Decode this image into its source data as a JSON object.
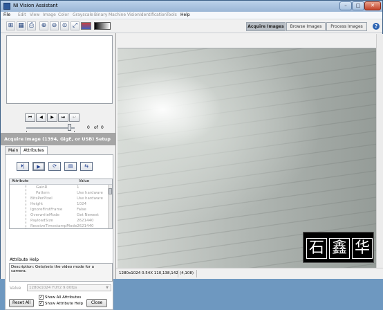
{
  "window": {
    "title": "NI Vision Assistant",
    "close_glyph": "✕",
    "min_glyph": "–",
    "max_glyph": "□"
  },
  "menu": [
    {
      "label": "File",
      "disabled": false
    },
    {
      "label": "Edit",
      "disabled": true
    },
    {
      "label": "View",
      "disabled": true
    },
    {
      "label": "Image",
      "disabled": true
    },
    {
      "label": "Color",
      "disabled": true
    },
    {
      "label": "Grayscale",
      "disabled": true
    },
    {
      "label": "Binary",
      "disabled": true
    },
    {
      "label": "Machine Vision",
      "disabled": true
    },
    {
      "label": "Identification",
      "disabled": true
    },
    {
      "label": "Tools",
      "disabled": true
    },
    {
      "label": "Help",
      "disabled": false
    }
  ],
  "toolbar": {
    "icons": [
      "acquire-icon",
      "browse-icon",
      "print-icon",
      "zoom-in-icon",
      "zoom-out-icon",
      "zoom-1to1-icon",
      "zoom-fit-icon",
      "color-palette-icon",
      "grayscale-gradient-icon"
    ],
    "glyphs": [
      "⊞",
      "▦",
      "⎙",
      "⊕",
      "⊖",
      "⊙",
      "⤢"
    ]
  },
  "modes": [
    {
      "label": "Acquire Images",
      "active": true
    },
    {
      "label": "Browse Images",
      "active": false
    },
    {
      "label": "Process Images",
      "active": false
    }
  ],
  "help_glyph": "?",
  "thumbnail_nav": {
    "first": "⏮",
    "prev": "◀",
    "next": "▶",
    "last": "⏭",
    "undo": "↩",
    "current": "0",
    "of_label": "of",
    "total": "0",
    "slider_fraction": 0.92
  },
  "setup": {
    "title": "Acquire Image (1394, GigE, or USB) Setup",
    "tabs": [
      {
        "label": "Main",
        "active": false
      },
      {
        "label": "Attributes",
        "active": true
      }
    ],
    "actions": [
      "⏵|",
      "▶",
      "⟳",
      "▤",
      "⇆"
    ],
    "grid_header": {
      "attribute": "Attribute",
      "value": "Value"
    },
    "attributes": [
      {
        "name": "GainR",
        "value": "1",
        "indent": 2
      },
      {
        "name": "Pattern",
        "value": "Use hardware",
        "indent": 2
      },
      {
        "name": "BitsPerPixel",
        "value": "Use hardware",
        "indent": 1
      },
      {
        "name": "Height",
        "value": "1024",
        "indent": 1
      },
      {
        "name": "IgnoreFirstFrame",
        "value": "False",
        "indent": 1
      },
      {
        "name": "OverwriteMode",
        "value": "Get Newest",
        "indent": 1
      },
      {
        "name": "PayloadSize",
        "value": "2621440",
        "indent": 1
      },
      {
        "name": "ReceiveTimestampMode",
        "value": "2621440",
        "indent": 1
      }
    ],
    "help_label": "Attribute Help",
    "help_text": "Description: Gets/sets the video mode for a camera.",
    "value_label": "Value",
    "value_selected": "1280x1024 YUY2 9.00fps",
    "reset_label": "Reset All",
    "show_all_label": "Show All Attributes",
    "show_help_label": "Show Attribute Help",
    "close_label": "Close"
  },
  "status": {
    "image_info": "1280x1024 0.54X 110,138,142",
    "coords": "(4,108)"
  },
  "watermark": {
    "chars": [
      "石",
      "鑫",
      "华"
    ]
  }
}
